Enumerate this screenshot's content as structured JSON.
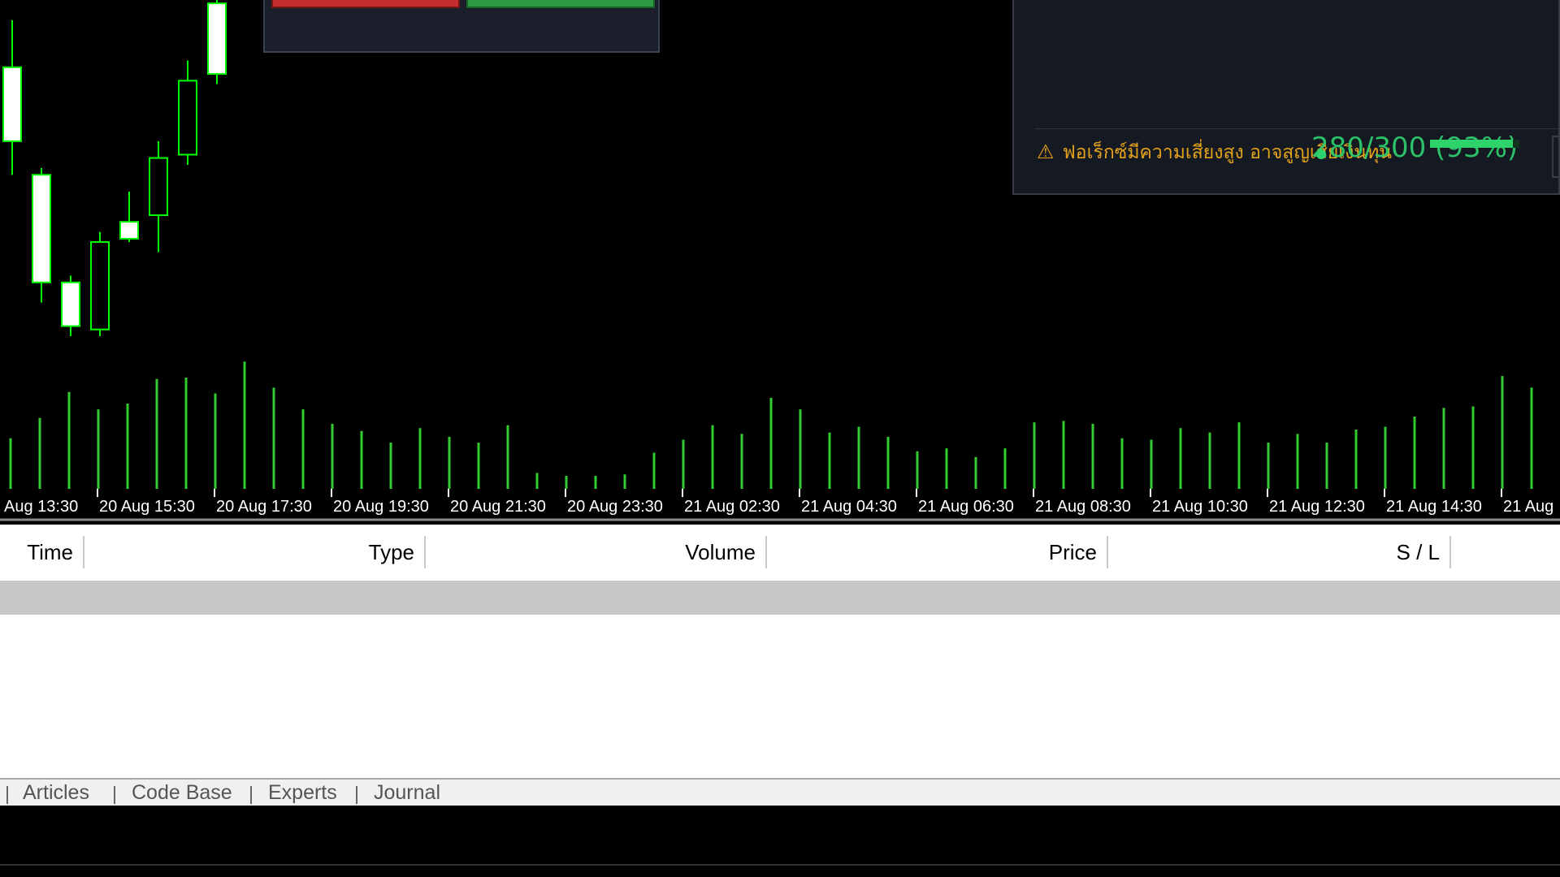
{
  "chart": {
    "background": "#000000",
    "candle_up_color": "#ffffff",
    "wick_color": "#00ff00",
    "volume_color": "#32cd32",
    "time_axis_labels": [
      "Aug 13:30",
      "20 Aug 15:30",
      "20 Aug 17:30",
      "20 Aug 19:30",
      "20 Aug 21:30",
      "20 Aug 23:30",
      "21 Aug 02:30",
      "21 Aug 04:30",
      "21 Aug 06:30",
      "21 Aug 08:30",
      "21 Aug 10:30",
      "21 Aug 12:30",
      "21 Aug 14:30",
      "21 Aug"
    ],
    "candles": [
      {
        "open": 0.8,
        "close": 0.58,
        "high": 0.94,
        "low": 0.48,
        "bull": true
      },
      {
        "open": 0.48,
        "close": 0.16,
        "high": 0.5,
        "low": 0.1,
        "bull": true
      },
      {
        "open": 0.16,
        "close": 0.03,
        "high": 0.18,
        "low": 0.0,
        "bull": true
      },
      {
        "open": 0.02,
        "close": 0.28,
        "high": 0.31,
        "low": 0.0,
        "bull": false
      },
      {
        "open": 0.34,
        "close": 0.29,
        "high": 0.43,
        "low": 0.28,
        "bull": true
      },
      {
        "open": 0.36,
        "close": 0.53,
        "high": 0.58,
        "low": 0.25,
        "bull": false
      },
      {
        "open": 0.54,
        "close": 0.76,
        "high": 0.82,
        "low": 0.51,
        "bull": false
      },
      {
        "open": 0.78,
        "close": 0.99,
        "high": 1.0,
        "low": 0.75,
        "bull": true
      }
    ],
    "volumes": [
      0.35,
      0.49,
      0.67,
      0.55,
      0.59,
      0.76,
      0.77,
      0.66,
      0.88,
      0.7,
      0.55,
      0.45,
      0.4,
      0.32,
      0.42,
      0.36,
      0.32,
      0.44,
      0.11,
      0.09,
      0.09,
      0.1,
      0.25,
      0.34,
      0.44,
      0.38,
      0.63,
      0.55,
      0.39,
      0.43,
      0.36,
      0.26,
      0.28,
      0.22,
      0.28,
      0.46,
      0.47,
      0.45,
      0.35,
      0.34,
      0.42,
      0.39,
      0.46,
      0.32,
      0.38,
      0.32,
      0.41,
      0.43,
      0.5,
      0.56,
      0.57,
      0.78,
      0.7
    ]
  },
  "trade_panel": {
    "sell_color": "#c62d2d",
    "buy_color": "#2e9a41"
  },
  "info_panel": {
    "warning_icon": "⚠",
    "warning_text": "ฟอเร็กซ์มีความเสี่ยงสูง อาจสูญเสียเงินทุน",
    "progress_text": "280/300 (93%)",
    "progress_fraction": 0.93
  },
  "table": {
    "headers": [
      "Time",
      "Type",
      "Volume",
      "Price",
      "S / L"
    ]
  },
  "tabs": [
    "Articles",
    "Code Base",
    "Experts",
    "Journal"
  ]
}
